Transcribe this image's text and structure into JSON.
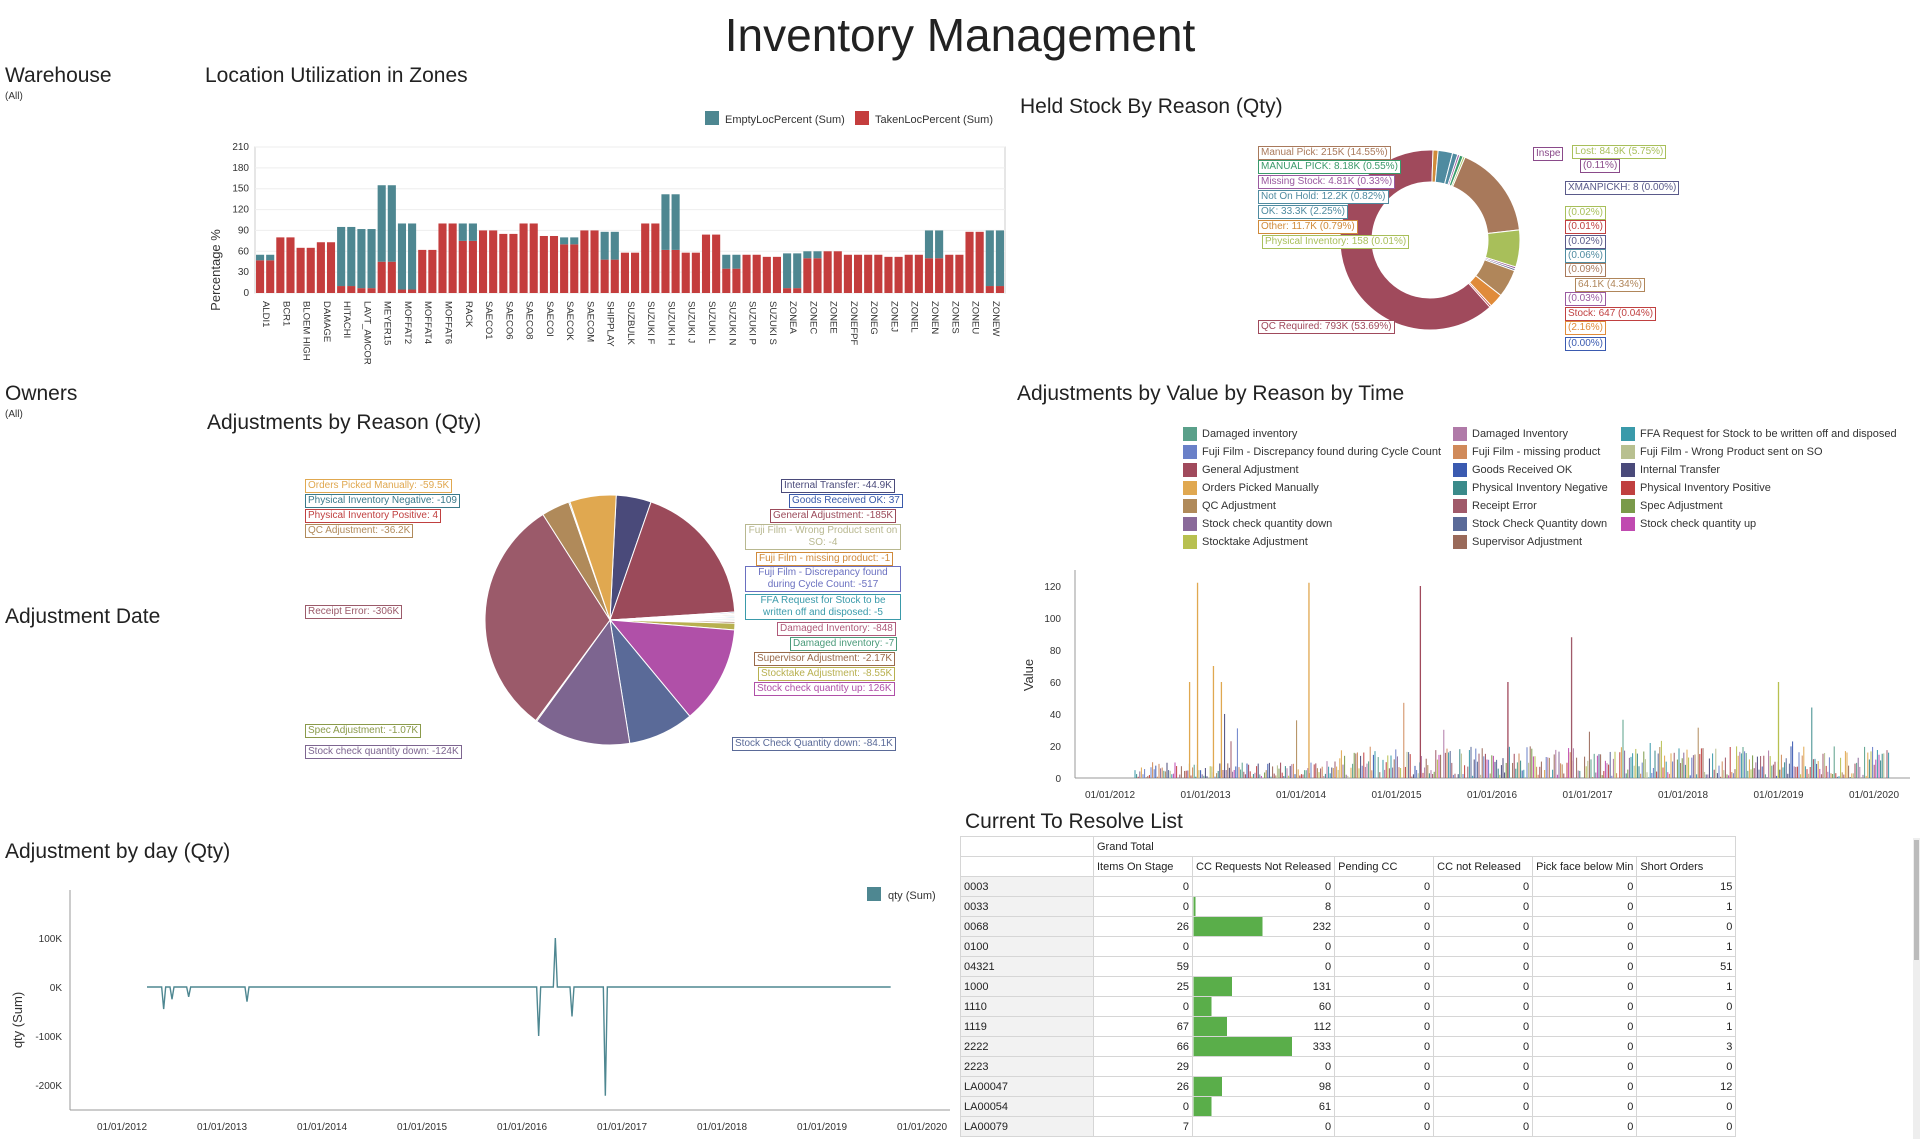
{
  "page": {
    "title": "Inventory Management"
  },
  "filters": {
    "warehouse": {
      "label": "Warehouse",
      "value": "(All)"
    },
    "owners": {
      "label": "Owners",
      "value": "(All)"
    },
    "adjustment_date": {
      "label": "Adjustment Date"
    }
  },
  "location_utilization": {
    "title": "Location Utilization in Zones",
    "chart_data": {
      "type": "bar",
      "title": "Location Utilization in Zones",
      "ylabel": "Percentage %",
      "ylim": [
        0,
        210
      ],
      "yticks": [
        0,
        30,
        60,
        90,
        120,
        150,
        180,
        210
      ],
      "legend": "top-right",
      "series": [
        {
          "name": "EmptyLocPercent (Sum)",
          "color": "#4e8791"
        },
        {
          "name": "TakenLocPercent (Sum)",
          "color": "#c43d3d"
        }
      ],
      "tick_labels": [
        "ALDI1",
        "BCR1",
        "BLOEM HIGH",
        "DAMAGE",
        "HITACHI",
        "LAVT_AMCOR",
        "MEYER15",
        "MOFFAT2",
        "MOFFAT4",
        "MOFFAT6",
        "RACK",
        "SAECO1",
        "SAECO6",
        "SAECO8",
        "SAECOI",
        "SAECOK",
        "SAECOM",
        "SHIPPLAY",
        "SUZBULK",
        "SUZUKI F",
        "SUZUKI H",
        "SUZUKI J",
        "SUZUKI L",
        "SUZUKI N",
        "SUZUKI P",
        "SUZUKI S",
        "ZONEA",
        "ZONEC",
        "ZONEE",
        "ZONEFPF",
        "ZONEG",
        "ZONEJ",
        "ZONEL",
        "ZONEN",
        "ZONES",
        "ZONEU",
        "ZONEW"
      ],
      "bars": [
        {
          "empty": 8,
          "taken": 47
        },
        {
          "empty": 0,
          "taken": 80
        },
        {
          "empty": 0,
          "taken": 65
        },
        {
          "empty": 0,
          "taken": 73
        },
        {
          "empty": 85,
          "taken": 10
        },
        {
          "empty": 85,
          "taken": 7
        },
        {
          "empty": 110,
          "taken": 45
        },
        {
          "empty": 95,
          "taken": 5
        },
        {
          "empty": 0,
          "taken": 62
        },
        {
          "empty": 0,
          "taken": 100
        },
        {
          "empty": 25,
          "taken": 75
        },
        {
          "empty": 0,
          "taken": 90
        },
        {
          "empty": 0,
          "taken": 85
        },
        {
          "empty": 0,
          "taken": 100
        },
        {
          "empty": 0,
          "taken": 82
        },
        {
          "empty": 10,
          "taken": 70
        },
        {
          "empty": 0,
          "taken": 90
        },
        {
          "empty": 40,
          "taken": 48
        },
        {
          "empty": 0,
          "taken": 58
        },
        {
          "empty": 0,
          "taken": 100
        },
        {
          "empty": 80,
          "taken": 62
        },
        {
          "empty": 0,
          "taken": 58
        },
        {
          "empty": 0,
          "taken": 84
        },
        {
          "empty": 20,
          "taken": 35
        },
        {
          "empty": 0,
          "taken": 55
        },
        {
          "empty": 0,
          "taken": 52
        },
        {
          "empty": 50,
          "taken": 7
        },
        {
          "empty": 10,
          "taken": 50
        },
        {
          "empty": 0,
          "taken": 60
        },
        {
          "empty": 0,
          "taken": 55
        },
        {
          "empty": 0,
          "taken": 55
        },
        {
          "empty": 0,
          "taken": 52
        },
        {
          "empty": 0,
          "taken": 55
        },
        {
          "empty": 40,
          "taken": 50
        },
        {
          "empty": 0,
          "taken": 55
        },
        {
          "empty": 0,
          "taken": 88
        },
        {
          "empty": 80,
          "taken": 10
        }
      ]
    }
  },
  "held_stock": {
    "title": "Held Stock By Reason (Qty)",
    "chart_data": {
      "type": "pie",
      "slices": [
        {
          "label": "QC Required",
          "display": "QC Required: 793K (53.69%)",
          "value": 53.69,
          "color": "#a04a5c"
        },
        {
          "label": "Manual Pick",
          "display": "Manual Pick: 215K (14.55%)",
          "value": 14.55,
          "color": "#a8795b"
        },
        {
          "label": "Lost",
          "display": "Lost: 84.9K (5.75%)",
          "value": 5.75,
          "color": "#a8bf5a"
        },
        {
          "label": "Other",
          "display": "Other: 11.7K (0.79%)",
          "value": 0.79,
          "color": "#d08a3a"
        },
        {
          "label": "OK",
          "display": "OK: 33.3K (2.25%)",
          "value": 2.25,
          "color": "#4f8ba0"
        },
        {
          "label": "Not On Hold",
          "display": "Not On Hold: 12.2K (0.82%)",
          "value": 0.82,
          "color": "#4f8ba0"
        },
        {
          "label": "Missing Stock",
          "display": "Missing Stock: 4.81K (0.33%)",
          "value": 0.33,
          "color": "#9a5aa0"
        },
        {
          "label": "MANUAL PICK",
          "display": "MANUAL PICK: 8.18K (0.55%)",
          "value": 0.55,
          "color": "#3a9a6a"
        },
        {
          "label": "64.1K (4.34%)",
          "display": "64.1K (4.34%)",
          "value": 4.34,
          "color": "#b0865a"
        },
        {
          "label": "Stock",
          "display": "Stock: 647 (0.04%)",
          "value": 0.04,
          "color": "#c04040"
        },
        {
          "label": "(2.16%)",
          "display": "(2.16%)",
          "value": 2.16,
          "color": "#e08b3a"
        },
        {
          "label": "Physical Inventory",
          "display": "Physical Inventory: 158 (0.01%)",
          "value": 0.01,
          "color": "#a8bf5a"
        },
        {
          "label": "Inspe",
          "display": "Inspe",
          "value": 0.11,
          "color": "#8a4a8a"
        },
        {
          "label": "XMANPICKH",
          "display": "XMANPICKH: 8 (0.00%)",
          "value": 0.0,
          "color": "#5a5a8a"
        }
      ],
      "extra_labels": [
        "(0.11%)",
        "(0.02%)",
        "(0.01%)",
        "(0.02%)",
        "(0.06%)",
        "(0.09%)",
        "(0.03%)",
        "(0.00%)"
      ]
    }
  },
  "adjustments_reason": {
    "title": "Adjustments by Reason (Qty)",
    "chart_data": {
      "type": "pie",
      "slices": [
        {
          "display": "Receipt Error: -306K",
          "value": 306,
          "color": "#9b5a6a"
        },
        {
          "display": "General Adjustment: -185K",
          "value": 185,
          "color": "#9b4a5a"
        },
        {
          "display": "Stock check quantity up: 126K",
          "value": 126,
          "color": "#b050a8"
        },
        {
          "display": "Stock check quantity down: -124K",
          "value": 124,
          "color": "#7d6590"
        },
        {
          "display": "Stock Check Quantity down: -84.1K",
          "value": 84.1,
          "color": "#5a6a98"
        },
        {
          "display": "Orders Picked Manually: -59.5K",
          "value": 59.5,
          "color": "#e0a850"
        },
        {
          "display": "Internal Transfer: -44.9K",
          "value": 44.9,
          "color": "#4a4a7a"
        },
        {
          "display": "QC Adjustment: -36.2K",
          "value": 36.2,
          "color": "#b08a5a"
        },
        {
          "display": "Stocktake Adjustment: -8.55K",
          "value": 8.55,
          "color": "#b8b050"
        },
        {
          "display": "Supervisor Adjustment: -2.17K",
          "value": 2.17,
          "color": "#9a6a4a"
        },
        {
          "display": "Spec Adjustment: -1.07K",
          "value": 1.07,
          "color": "#8a9a4a"
        },
        {
          "display": "Damaged Inventory: -848",
          "value": 0.848,
          "color": "#b05a7a"
        },
        {
          "display": "Fuji Film - Discrepancy found during Cycle Count: -517",
          "value": 0.517,
          "color": "#6a70c0"
        },
        {
          "display": "Physical Inventory Negative: -109",
          "value": 0.109,
          "color": "#3a7a8a"
        },
        {
          "display": "Goods Received OK: 37",
          "value": 0.037,
          "color": "#3a5aaa"
        },
        {
          "display": "Damaged inventory: -7",
          "value": 0.007,
          "color": "#4a9a7a"
        },
        {
          "display": "FFA Request for Stock to be written off and disposed: -5",
          "value": 0.005,
          "color": "#3a9aaa"
        },
        {
          "display": "Fuji Film - Wrong Product sent on SO: -4",
          "value": 0.004,
          "color": "#b8b890"
        },
        {
          "display": "Physical Inventory Positive: 4",
          "value": 0.004,
          "color": "#c04040"
        },
        {
          "display": "Fuji Film - missing product: -1",
          "value": 0.001,
          "color": "#d08a3a"
        }
      ]
    }
  },
  "adjustments_value": {
    "title": "Adjustments by Value by Reason by Time",
    "legend": [
      {
        "label": "Damaged inventory",
        "color": "#5aa08a"
      },
      {
        "label": "Damaged Inventory",
        "color": "#b07aa8"
      },
      {
        "label": "FFA Request for Stock to be written off and disposed",
        "color": "#3a9aaa"
      },
      {
        "label": "Fuji Film - Discrepancy found during Cycle Count",
        "color": "#6a80c8"
      },
      {
        "label": "Fuji Film - missing product",
        "color": "#d08a5a"
      },
      {
        "label": "Fuji Film - Wrong Product sent on SO",
        "color": "#b8c090"
      },
      {
        "label": "General Adjustment",
        "color": "#a04a5c"
      },
      {
        "label": "Goods Received OK",
        "color": "#3a5ab0"
      },
      {
        "label": "Internal Transfer",
        "color": "#4a4a7a"
      },
      {
        "label": "Orders Picked Manually",
        "color": "#e0a850"
      },
      {
        "label": "Physical Inventory Negative",
        "color": "#3a8a8a"
      },
      {
        "label": "Physical Inventory Positive",
        "color": "#c04040"
      },
      {
        "label": "QC Adjustment",
        "color": "#b08a5a"
      },
      {
        "label": "Receipt Error",
        "color": "#a05a6a"
      },
      {
        "label": "Spec Adjustment",
        "color": "#7a9a4a"
      },
      {
        "label": "Stock check quantity down",
        "color": "#8a6a9a"
      },
      {
        "label": "Stock Check Quantity down",
        "color": "#5a6a98"
      },
      {
        "label": "Stock check quantity up",
        "color": "#c04ab0"
      },
      {
        "label": "Stocktake Adjustment",
        "color": "#b8c050"
      },
      {
        "label": "Supervisor Adjustment",
        "color": "#9a6a5a"
      }
    ],
    "chart_data": {
      "type": "bar",
      "ylabel": "Value",
      "ylim": [
        0,
        130
      ],
      "yticks": [
        0,
        20,
        40,
        60,
        80,
        100,
        120
      ],
      "xticks": [
        "01/01/2012",
        "01/01/2013",
        "01/01/2014",
        "01/01/2015",
        "01/01/2016",
        "01/01/2017",
        "01/01/2018",
        "01/01/2019",
        "01/01/2020"
      ],
      "spikes": [
        {
          "x": "2012-11",
          "y": 60,
          "series": "Orders Picked Manually"
        },
        {
          "x": "2012-12",
          "y": 122,
          "series": "Orders Picked Manually"
        },
        {
          "x": "2013-02",
          "y": 70,
          "series": "Orders Picked Manually"
        },
        {
          "x": "2013-03",
          "y": 60,
          "series": "Orders Picked Manually"
        },
        {
          "x": "2014-02",
          "y": 122,
          "series": "Orders Picked Manually"
        },
        {
          "x": "2015-04",
          "y": 120,
          "series": "General Adjustment"
        },
        {
          "x": "2016-03",
          "y": 60,
          "series": "General Adjustment"
        },
        {
          "x": "2016-11",
          "y": 88,
          "series": "Receipt Error"
        },
        {
          "x": "2019-01",
          "y": 60,
          "series": "Stocktake Adjustment"
        }
      ]
    }
  },
  "adjustment_by_day": {
    "title": "Adjustment by day (Qty)",
    "chart_data": {
      "type": "line",
      "ylabel": "qty (Sum)",
      "ylim": [
        -230,
        120
      ],
      "yticks": [
        "100K",
        "0K",
        "-100K",
        "-200K"
      ],
      "xticks": [
        "01/01/2012",
        "01/01/2013",
        "01/01/2014",
        "01/01/2015",
        "01/01/2016",
        "01/01/2017",
        "01/01/2018",
        "01/01/2019",
        "01/01/2020"
      ],
      "series": [
        {
          "name": "qty (Sum)",
          "color": "#4e8791"
        }
      ],
      "points": [
        {
          "x": "2012-04",
          "y": 0
        },
        {
          "x": "2012-06",
          "y": -45
        },
        {
          "x": "2012-07",
          "y": -25
        },
        {
          "x": "2012-09",
          "y": -20
        },
        {
          "x": "2013-04",
          "y": -30
        },
        {
          "x": "2016-03",
          "y": -100
        },
        {
          "x": "2016-05",
          "y": 100
        },
        {
          "x": "2016-07",
          "y": -60
        },
        {
          "x": "2016-11",
          "y": -222
        },
        {
          "x": "2019-09",
          "y": 0
        }
      ]
    }
  },
  "resolve_list": {
    "title": "Current To Resolve List",
    "group_header": "Grand Total",
    "columns": [
      "Items On Stage",
      "CC Requests Not Released",
      "Pending CC",
      "CC not Released",
      "Pick face below Min",
      "Short Orders"
    ],
    "cc_max": 333,
    "rows": [
      {
        "key": "0003",
        "v": [
          0,
          0,
          0,
          0,
          0,
          15
        ]
      },
      {
        "key": "0033",
        "v": [
          0,
          8,
          0,
          0,
          0,
          1
        ]
      },
      {
        "key": "0068",
        "v": [
          26,
          232,
          0,
          0,
          0,
          0
        ]
      },
      {
        "key": "0100",
        "v": [
          0,
          0,
          0,
          0,
          0,
          1
        ]
      },
      {
        "key": "04321",
        "v": [
          59,
          0,
          0,
          0,
          0,
          51
        ]
      },
      {
        "key": "1000",
        "v": [
          25,
          131,
          0,
          0,
          0,
          1
        ]
      },
      {
        "key": "1110",
        "v": [
          0,
          60,
          0,
          0,
          0,
          0
        ]
      },
      {
        "key": "1119",
        "v": [
          67,
          112,
          0,
          0,
          0,
          1
        ]
      },
      {
        "key": "2222",
        "v": [
          66,
          333,
          0,
          0,
          0,
          3
        ]
      },
      {
        "key": "2223",
        "v": [
          29,
          0,
          0,
          0,
          0,
          0
        ]
      },
      {
        "key": "LA00047",
        "v": [
          26,
          98,
          0,
          0,
          0,
          12
        ]
      },
      {
        "key": "LA00054",
        "v": [
          0,
          61,
          0,
          0,
          0,
          0
        ]
      },
      {
        "key": "LA00079",
        "v": [
          7,
          0,
          0,
          0,
          0,
          0
        ]
      }
    ]
  }
}
